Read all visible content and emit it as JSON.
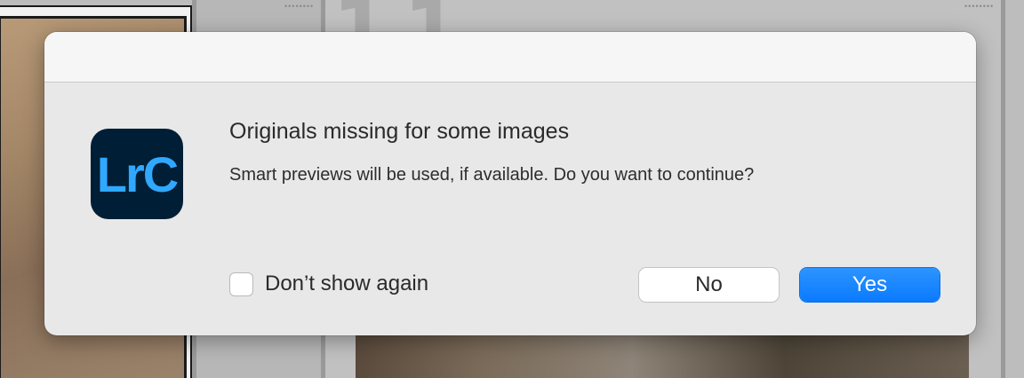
{
  "dialog": {
    "app_icon_text": "LrC",
    "title": "Originals missing for some images",
    "message": "Smart previews will be used, if available. Do you want to continue?",
    "checkbox_label": "Don’t show again",
    "checkbox_checked": false,
    "no_label": "No",
    "yes_label": "Yes",
    "accent_color": "#0a7aff",
    "icon_background": "#001e36",
    "icon_text_color": "#31a8ff"
  },
  "background": {
    "grid_cell_dots": "••••••••",
    "ghost_numbers": [
      "1",
      "1"
    ]
  }
}
